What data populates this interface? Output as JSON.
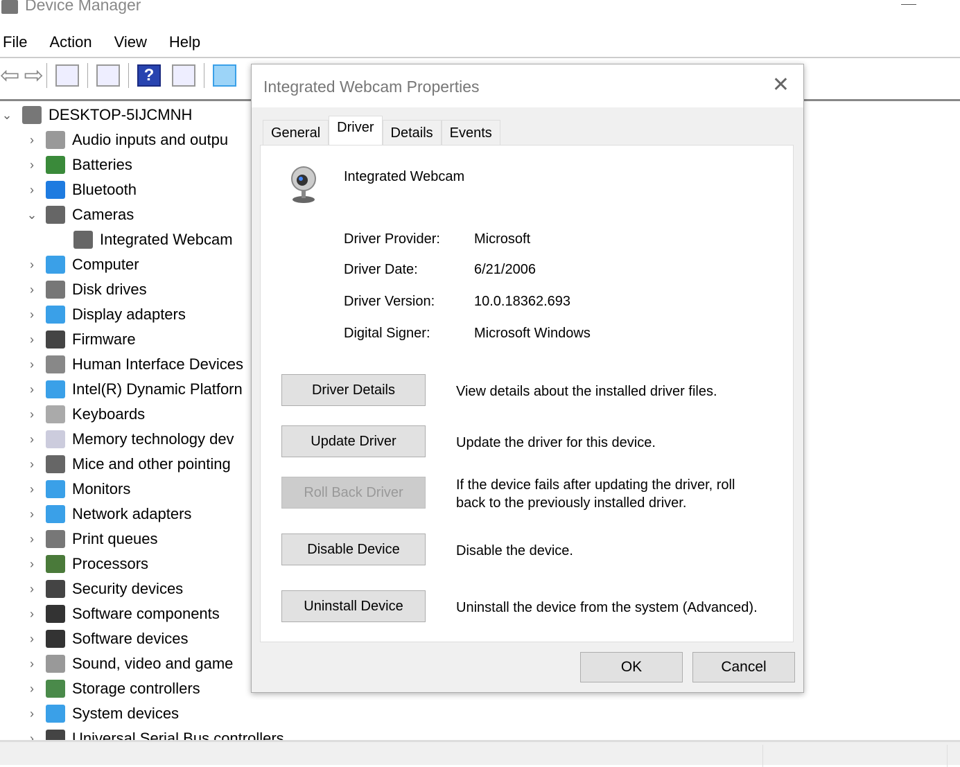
{
  "window": {
    "title": "Device Manager"
  },
  "menu": [
    "File",
    "Action",
    "View",
    "Help"
  ],
  "tree": {
    "root": "DESKTOP-5IJCMNH",
    "items": [
      {
        "label": "Audio inputs and outpu",
        "icon": "speaker-icon",
        "color": "#999"
      },
      {
        "label": "Batteries",
        "icon": "battery-icon",
        "color": "#3a8a3a"
      },
      {
        "label": "Bluetooth",
        "icon": "bluetooth-icon",
        "color": "#1e7be0"
      },
      {
        "label": "Cameras",
        "icon": "camera-icon",
        "color": "#666",
        "expanded": true
      },
      {
        "label": "Integrated Webcam",
        "icon": "webcam-icon",
        "color": "#666",
        "child": true
      },
      {
        "label": "Computer",
        "icon": "computer-icon",
        "color": "#3aa0e8"
      },
      {
        "label": "Disk drives",
        "icon": "disk-icon",
        "color": "#777"
      },
      {
        "label": "Display adapters",
        "icon": "display-adapter-icon",
        "color": "#3aa0e8"
      },
      {
        "label": "Firmware",
        "icon": "firmware-icon",
        "color": "#444"
      },
      {
        "label": "Human Interface Devices",
        "icon": "hid-icon",
        "color": "#888"
      },
      {
        "label": "Intel(R) Dynamic Platforn",
        "icon": "platform-icon",
        "color": "#3aa0e8"
      },
      {
        "label": "Keyboards",
        "icon": "keyboard-icon",
        "color": "#aaa"
      },
      {
        "label": "Memory technology dev",
        "icon": "memory-icon",
        "color": "#ccd"
      },
      {
        "label": "Mice and other pointing",
        "icon": "mouse-icon",
        "color": "#666"
      },
      {
        "label": "Monitors",
        "icon": "monitor-icon",
        "color": "#3aa0e8"
      },
      {
        "label": "Network adapters",
        "icon": "network-icon",
        "color": "#3aa0e8"
      },
      {
        "label": "Print queues",
        "icon": "printer-icon",
        "color": "#777"
      },
      {
        "label": "Processors",
        "icon": "processor-icon",
        "color": "#4a7a3a"
      },
      {
        "label": "Security devices",
        "icon": "security-icon",
        "color": "#444"
      },
      {
        "label": "Software components",
        "icon": "software-component-icon",
        "color": "#333"
      },
      {
        "label": "Software devices",
        "icon": "software-device-icon",
        "color": "#333"
      },
      {
        "label": "Sound, video and game",
        "icon": "sound-icon",
        "color": "#999"
      },
      {
        "label": "Storage controllers",
        "icon": "storage-icon",
        "color": "#4a8a4a"
      },
      {
        "label": "System devices",
        "icon": "system-icon",
        "color": "#3aa0e8"
      },
      {
        "label": "Universal Serial Bus controllers",
        "icon": "usb-icon",
        "color": "#444"
      }
    ]
  },
  "dialog": {
    "title": "Integrated Webcam Properties",
    "tabs": [
      "General",
      "Driver",
      "Details",
      "Events"
    ],
    "active_tab": "Driver",
    "device_name": "Integrated Webcam",
    "fields": [
      {
        "label": "Driver Provider:",
        "value": "Microsoft"
      },
      {
        "label": "Driver Date:",
        "value": "6/21/2006"
      },
      {
        "label": "Driver Version:",
        "value": "10.0.18362.693"
      },
      {
        "label": "Digital Signer:",
        "value": "Microsoft Windows"
      }
    ],
    "actions": [
      {
        "label": "Driver Details",
        "desc": "View details about the installed driver files.",
        "enabled": true
      },
      {
        "label": "Update Driver",
        "desc": "Update the driver for this device.",
        "enabled": true
      },
      {
        "label": "Roll Back Driver",
        "desc": "If the device fails after updating the driver, roll back to the previously installed driver.",
        "enabled": false
      },
      {
        "label": "Disable Device",
        "desc": "Disable the device.",
        "enabled": true
      },
      {
        "label": "Uninstall Device",
        "desc": "Uninstall the device from the system (Advanced).",
        "enabled": true
      }
    ],
    "ok": "OK",
    "cancel": "Cancel"
  }
}
